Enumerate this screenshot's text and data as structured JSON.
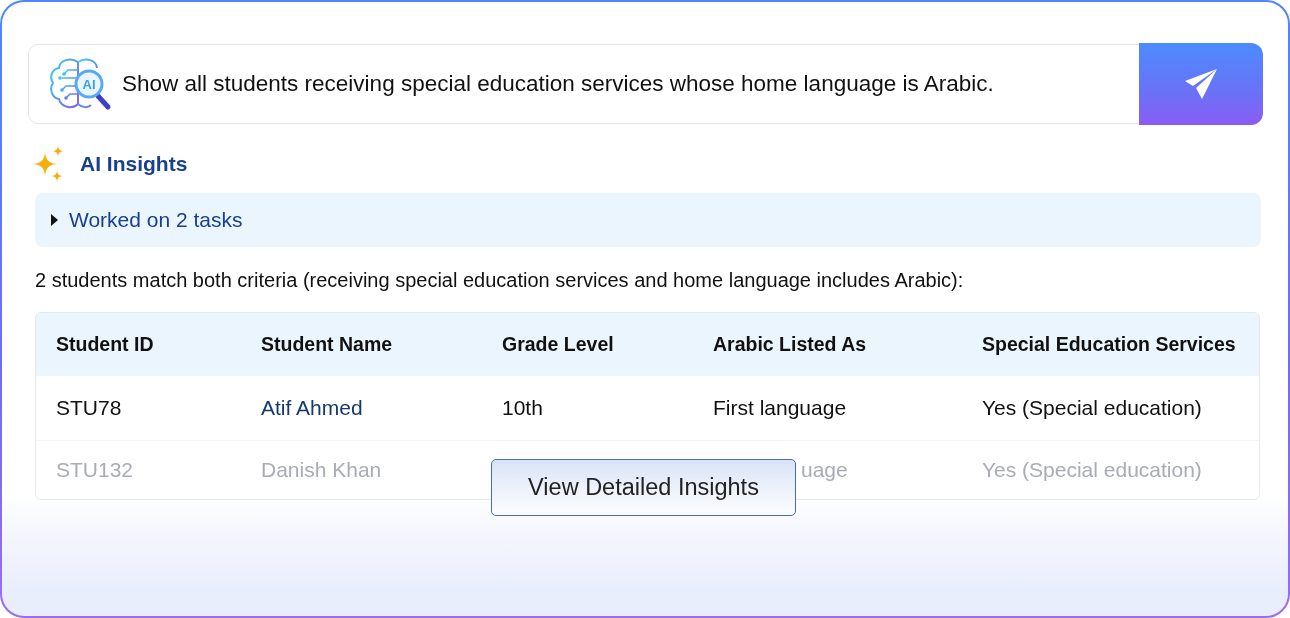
{
  "query": {
    "logo_text": "AI",
    "text": "Show all students receiving special education services whose home language is Arabic."
  },
  "insights": {
    "title": "AI Insights",
    "tasks": {
      "label": "Worked on 2 tasks",
      "expanded": false
    },
    "summary": "2 students match both criteria (receiving special education services and home language includes Arabic):"
  },
  "table": {
    "columns": [
      "Student ID",
      "Student Name",
      "Grade Level",
      "Arabic Listed As",
      "Special Education Services"
    ],
    "rows": [
      {
        "faded": false,
        "student_id": "STU78",
        "student_name": "Atif Ahmed",
        "grade_level": "10th",
        "arabic_listed_as": "First language",
        "special_education_services": "Yes (Special education)"
      },
      {
        "faded": true,
        "student_id": "STU132",
        "student_name": "Danish Khan",
        "arabic_listed_as": "uage",
        "special_education_services": "Yes (Special education)"
      }
    ]
  },
  "button": {
    "label": "View Detailed Insights"
  }
}
